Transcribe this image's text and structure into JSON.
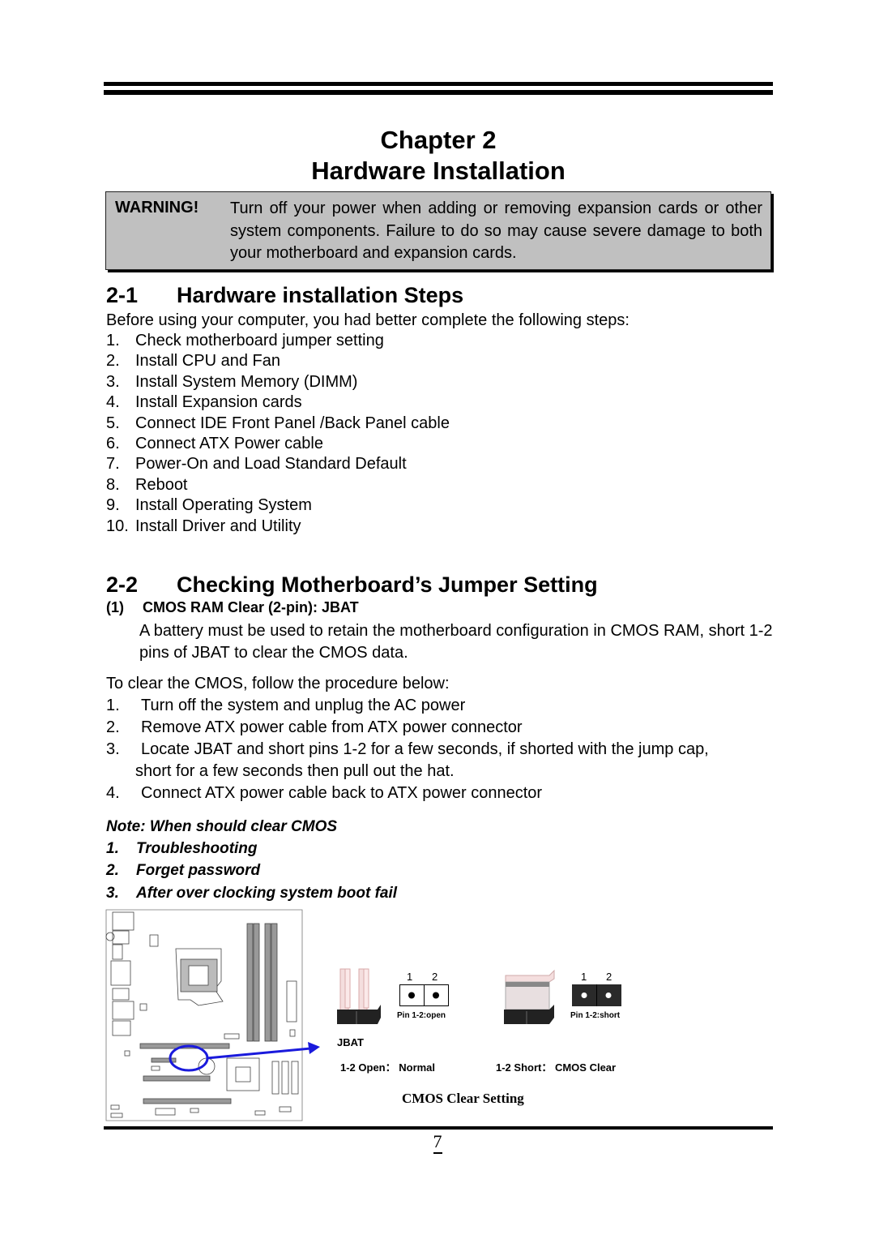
{
  "header": {
    "chapter": "Chapter 2",
    "title": "Hardware Installation"
  },
  "warning": {
    "label": "WARNING!",
    "text": "Turn off your power when adding or removing expansion cards or other system components. Failure to do so may cause severe damage to both your motherboard and expansion cards."
  },
  "section1": {
    "number": "2-1",
    "title": "Hardware installation Steps",
    "intro": "Before using your computer, you had better complete the following steps:",
    "steps": [
      {
        "n": "1.",
        "text": "Check motherboard jumper setting"
      },
      {
        "n": "2.",
        "text": "Install CPU and Fan"
      },
      {
        "n": "3.",
        "text": "Install System Memory (DIMM)"
      },
      {
        "n": "4.",
        "text": "Install Expansion cards"
      },
      {
        "n": "5.",
        "text": "Connect IDE Front Panel /Back Panel cable"
      },
      {
        "n": "6.",
        "text": "Connect ATX Power cable"
      },
      {
        "n": "7.",
        "text": "Power-On and Load Standard Default"
      },
      {
        "n": "8.",
        "text": "Reboot"
      },
      {
        "n": "9.",
        "text": "Install Operating System"
      },
      {
        "n": "10.",
        "text": "Install Driver and Utility"
      }
    ]
  },
  "section2": {
    "number": "2-2",
    "title": "Checking Motherboard’s Jumper Setting",
    "subsection": {
      "number": "(1)",
      "title": "CMOS RAM Clear (2-pin): JBAT",
      "body": "A battery must be used to retain the motherboard configuration in CMOS RAM, short 1-2 pins of JBAT to clear the CMOS data."
    },
    "procedure_intro": "To clear the CMOS, follow the procedure below:",
    "procedure": [
      {
        "n": "1.",
        "text": "Turn off the system and unplug the AC power",
        "cont": ""
      },
      {
        "n": "2.",
        "text": "Remove ATX power cable from ATX power connector",
        "cont": ""
      },
      {
        "n": "3.",
        "text": "Locate JBAT and short pins 1-2 for a few seconds, if shorted with the jump cap,",
        "cont": "short for a few seconds then pull out the hat."
      },
      {
        "n": "4.",
        "text": "Connect ATX power cable back to ATX power connector",
        "cont": ""
      }
    ],
    "note": {
      "title": "Note: When should clear CMOS",
      "items": [
        {
          "n": "1.",
          "text": "Troubleshooting"
        },
        {
          "n": "2.",
          "text": "Forget password"
        },
        {
          "n": "3.",
          "text": "After over clocking system boot fail"
        }
      ]
    }
  },
  "figure": {
    "jumper_name": "JBAT",
    "pin1": "1",
    "pin2": "2",
    "open_caption": "Pin 1-2:open",
    "short_caption": "Pin 1-2:short",
    "open_legend": "1-2 Open： Normal",
    "short_legend": "1-2 Short： CMOS Clear",
    "caption": "CMOS Clear Setting",
    "highlight_color": "#1a1adc"
  },
  "footer": {
    "page_number": "7"
  }
}
